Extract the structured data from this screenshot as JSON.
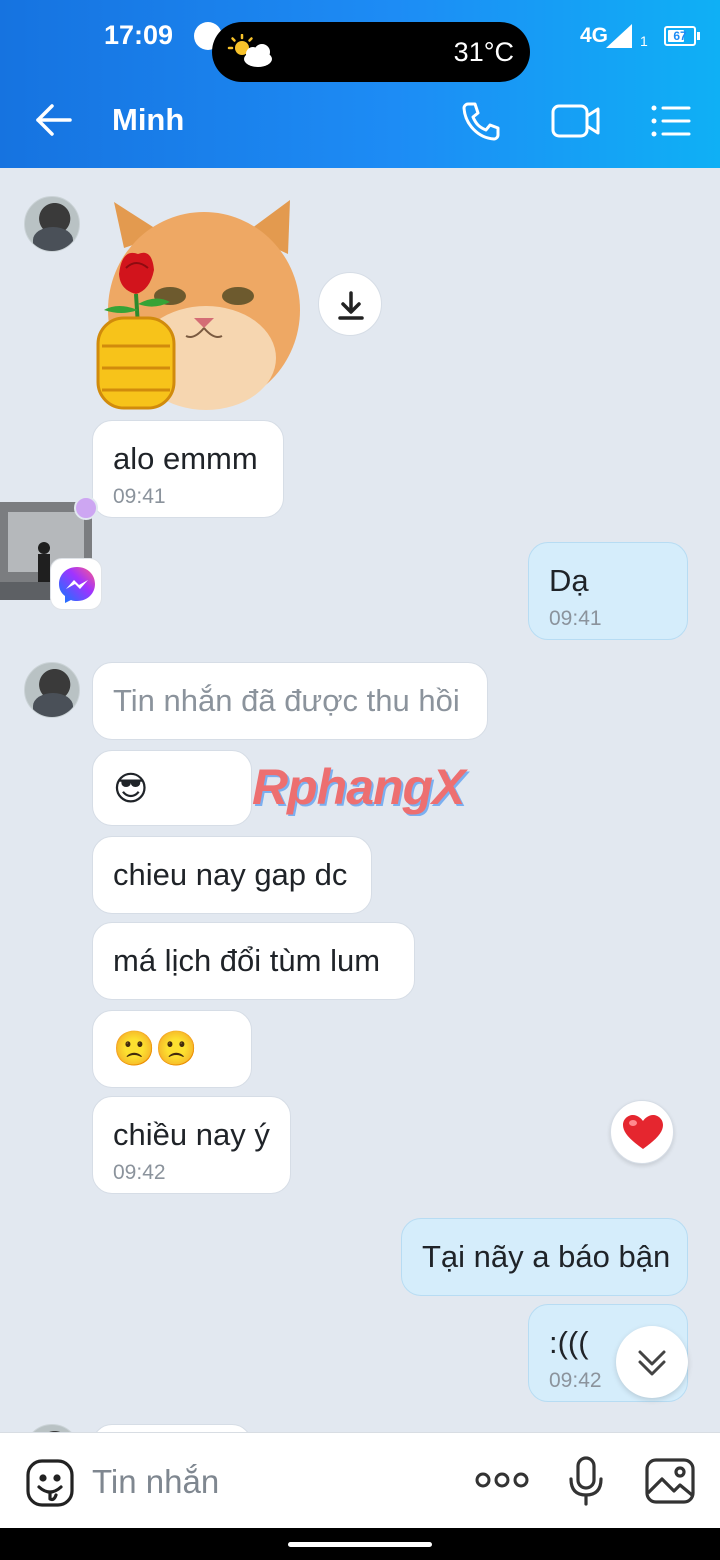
{
  "status_bar": {
    "time": "17:09",
    "temperature": "31°C",
    "network": "4G",
    "sim_slot": "1",
    "battery_level": "67",
    "battery_fraction": 0.67
  },
  "header": {
    "contact_name": "Minh",
    "icons": [
      "back-arrow-icon",
      "phone-icon",
      "video-call-icon",
      "menu-list-icon"
    ]
  },
  "messages": [
    {
      "id": "m1",
      "sender": "them",
      "type": "sticker",
      "description": "cat-with-rose-sticker"
    },
    {
      "id": "m2",
      "sender": "them",
      "text": "alo emmm",
      "time": "09:41"
    },
    {
      "id": "m3",
      "sender": "me",
      "text": "Dạ",
      "time": "09:41"
    },
    {
      "id": "m4",
      "sender": "them",
      "text": "Tin nhắn đã được thu hồi",
      "recalled": true
    },
    {
      "id": "m5",
      "sender": "them",
      "text": "😎"
    },
    {
      "id": "m6",
      "sender": "them",
      "text": "chieu nay gap dc"
    },
    {
      "id": "m7",
      "sender": "them",
      "text": "má lịch đổi tùm lum"
    },
    {
      "id": "m8",
      "sender": "them",
      "text": "🙁🙁"
    },
    {
      "id": "m9",
      "sender": "them",
      "text": "chiều nay ý",
      "time": "09:42"
    },
    {
      "id": "m10",
      "sender": "me",
      "text": "Tại nãy a báo bận"
    },
    {
      "id": "m11",
      "sender": "me",
      "text": ":(((",
      "time": "09:42"
    }
  ],
  "watermark": "RphangX",
  "reaction": "heart",
  "input": {
    "placeholder": "Tin nhắn"
  },
  "colors": {
    "header_start": "#1673e0",
    "header_end": "#0fb0f5",
    "my_bubble": "#d5edfb",
    "their_bubble": "#ffffff",
    "chat_bg": "#e2e8f0"
  }
}
